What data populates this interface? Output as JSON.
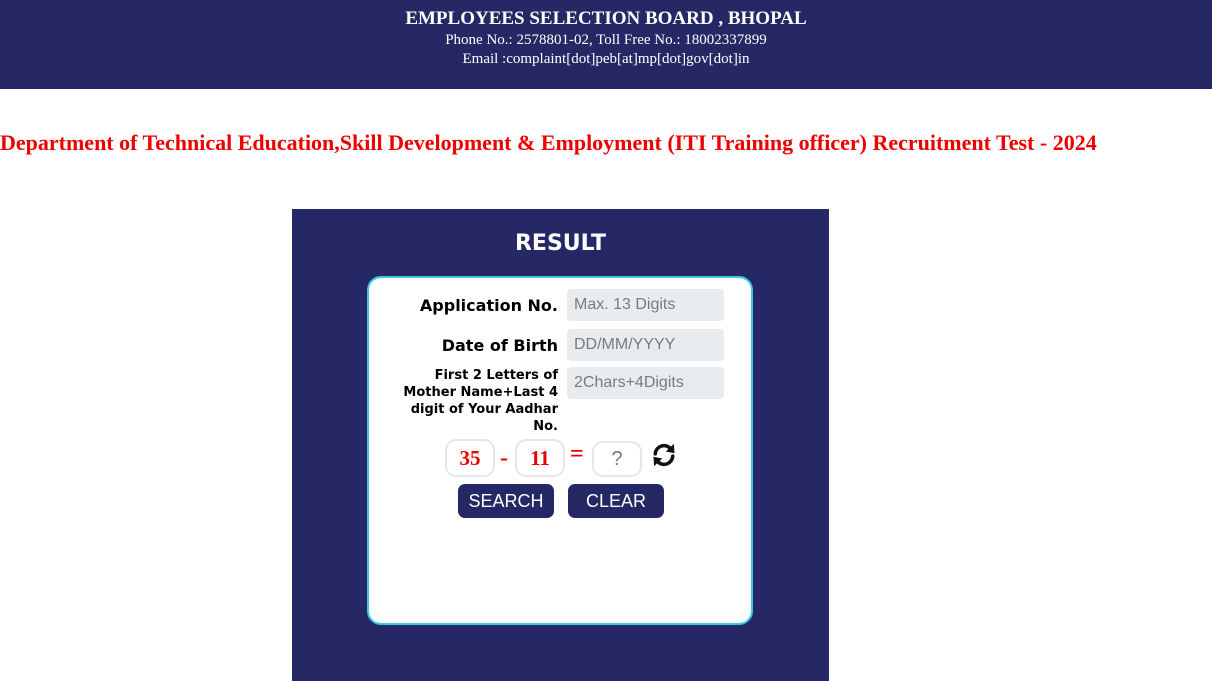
{
  "header": {
    "organization": "EMPLOYEES SELECTION BOARD , BHOPAL",
    "phone": "Phone No.: 2578801-02, Toll Free No.: 18002337899",
    "email": "Email :complaint[dot]peb[at]mp[dot]gov[dot]in",
    "background": "#262865"
  },
  "page_title": "Department of Technical Education,Skill Development & Employment (ITI Training officer) Recruitment Test - 2024",
  "title_color": "#ee0000",
  "result": {
    "heading": "RESULT",
    "application_no": {
      "label": "Application No.",
      "placeholder": "Max. 13 Digits",
      "value": ""
    },
    "date_of_birth": {
      "label": "Date of Birth",
      "placeholder": "DD/MM/YYYY",
      "value": ""
    },
    "mother_aadhar": {
      "label": "First 2 Letters of Mother Name+Last 4 digit of Your Aadhar No.",
      "placeholder": "2Chars+4Digits",
      "value": ""
    },
    "captcha": {
      "operand_a": "35",
      "operator": "-",
      "operand_b": "11",
      "equals": "=",
      "answer_placeholder": "?",
      "refresh_icon": "refresh-icon"
    },
    "buttons": {
      "search": "SEARCH",
      "clear": "CLEAR"
    },
    "card_border_color": "#3ec6e8"
  }
}
